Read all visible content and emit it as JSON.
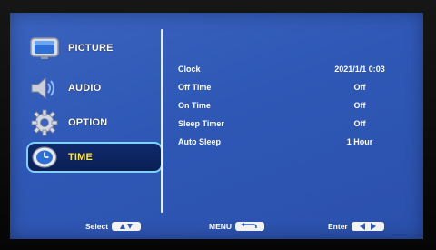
{
  "menu": {
    "items": [
      {
        "label": "PICTURE",
        "icon": "picture-icon"
      },
      {
        "label": "AUDIO",
        "icon": "speaker-icon"
      },
      {
        "label": "OPTION",
        "icon": "gear-icon"
      },
      {
        "label": "TIME",
        "icon": "clock-icon",
        "selected": true
      }
    ]
  },
  "time_settings": [
    {
      "label": "Clock",
      "value": "2021/1/1 0:03"
    },
    {
      "label": "Off Time",
      "value": "Off"
    },
    {
      "label": "On Time",
      "value": "Off"
    },
    {
      "label": "Sleep Timer",
      "value": "Off"
    },
    {
      "label": "Auto Sleep",
      "value": "1 Hour"
    }
  ],
  "footer": {
    "select_label": "Select",
    "menu_label": "MENU",
    "enter_label": "Enter"
  },
  "colors": {
    "screen_bg": "#3a63bf",
    "selected_border": "#7fd2ff",
    "selected_text": "#ffe84a",
    "text": "#ffffff"
  }
}
